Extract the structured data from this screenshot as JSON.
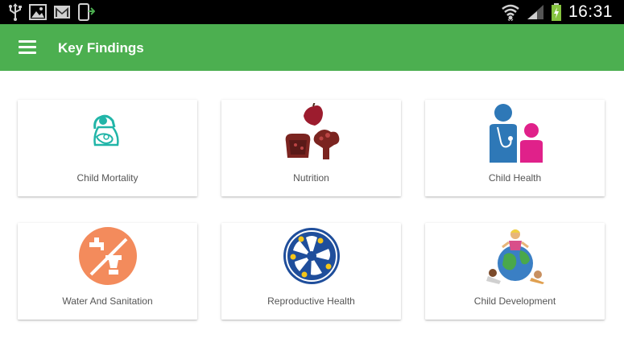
{
  "status_bar": {
    "time": "16:31",
    "left_icons": [
      "usb-icon",
      "image-icon",
      "gmail-icon",
      "phone-icon"
    ],
    "right_icons": [
      "wifi-icon",
      "signal-icon",
      "battery-charging-icon"
    ]
  },
  "app_bar": {
    "title": "Key Findings",
    "menu_icon": "hamburger-menu-icon",
    "color": "#4caf50"
  },
  "cards": [
    {
      "label": "Child Mortality",
      "icon": "child-mortality-icon"
    },
    {
      "label": "Nutrition",
      "icon": "nutrition-icon"
    },
    {
      "label": "Child Health",
      "icon": "child-health-icon"
    },
    {
      "label": "Water And Sanitation",
      "icon": "water-sanitation-icon"
    },
    {
      "label": "Reproductive Health",
      "icon": "reproductive-health-icon"
    },
    {
      "label": "Child Development",
      "icon": "child-development-icon"
    }
  ]
}
